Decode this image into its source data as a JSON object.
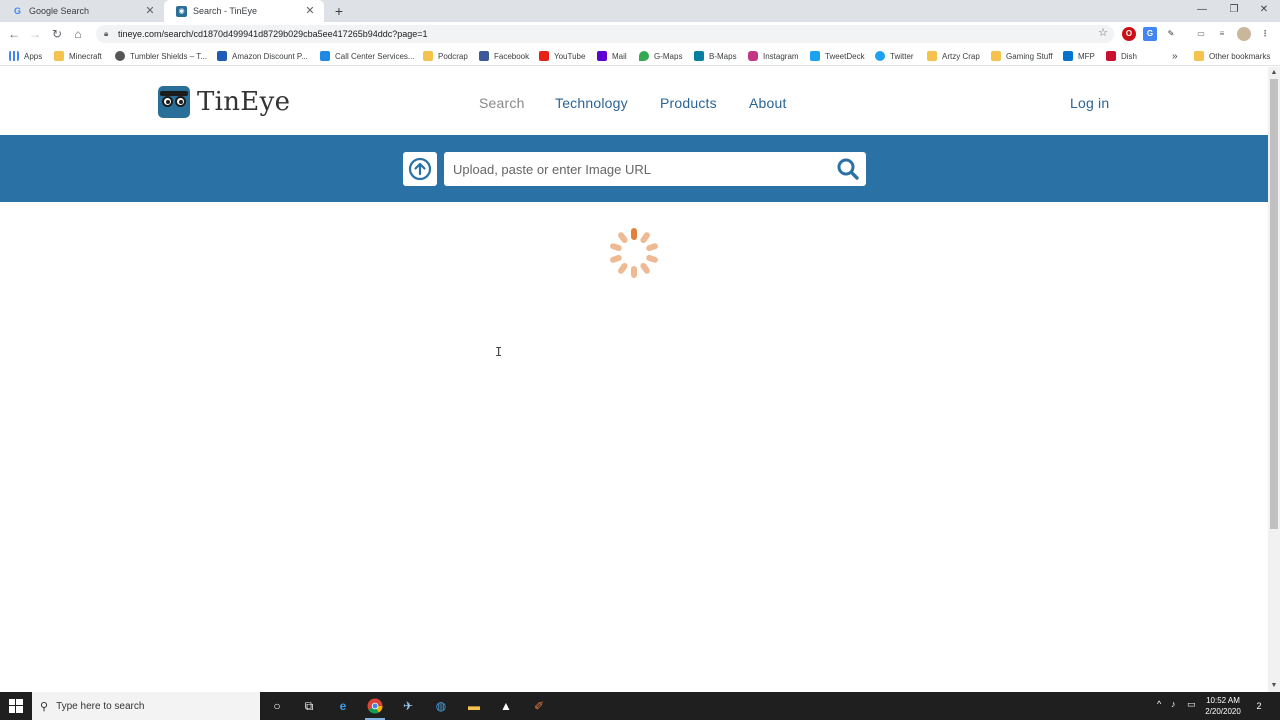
{
  "browser": {
    "tabs": [
      {
        "title": "Google Search",
        "favicon": "google-icon",
        "active": false
      },
      {
        "title": "Search - TinEye",
        "favicon": "tineye-icon",
        "active": true
      }
    ],
    "new_tab_symbol": "+",
    "address": "tineye.com/search/cd1870d499941d8729b029cba5ee417265b94ddc?page=1",
    "bookmarks": [
      {
        "label": "Apps",
        "icon": "apps-grid-icon",
        "color": "#4285f4"
      },
      {
        "label": "Minecraft",
        "icon": "folder-icon",
        "color": "#f4c24d"
      },
      {
        "label": "Tumbler Shields – T...",
        "icon": "globe-icon",
        "color": "#555555"
      },
      {
        "label": "Amazon Discount P...",
        "icon": "n-logo-icon",
        "color": "#1f5bb5"
      },
      {
        "label": "Call Center Services...",
        "icon": "page-icon",
        "color": "#1e88e5"
      },
      {
        "label": "Podcrap",
        "icon": "folder-icon",
        "color": "#f4c24d"
      },
      {
        "label": "Facebook",
        "icon": "facebook-icon",
        "color": "#3b5998"
      },
      {
        "label": "YouTube",
        "icon": "youtube-icon",
        "color": "#e62117"
      },
      {
        "label": "Mail",
        "icon": "mail-icon",
        "color": "#6001d2"
      },
      {
        "label": "G-Maps",
        "icon": "maps-pin-icon",
        "color": "#34a853"
      },
      {
        "label": "B-Maps",
        "icon": "bing-icon",
        "color": "#00809d"
      },
      {
        "label": "Instagram",
        "icon": "instagram-icon",
        "color": "#c13584"
      },
      {
        "label": "TweetDeck",
        "icon": "tweetdeck-icon",
        "color": "#1da1f2"
      },
      {
        "label": "Twitter",
        "icon": "twitter-icon",
        "color": "#1da1f2"
      },
      {
        "label": "Artzy Crap",
        "icon": "folder-icon",
        "color": "#f4c24d"
      },
      {
        "label": "Gaming Stuff",
        "icon": "folder-icon",
        "color": "#f4c24d"
      },
      {
        "label": "MFP",
        "icon": "mfp-icon",
        "color": "#0073cf"
      },
      {
        "label": "Dish",
        "icon": "dish-icon",
        "color": "#c8102e"
      }
    ],
    "more_bookmarks_symbol": "»",
    "other_bookmarks": "Other bookmarks"
  },
  "site": {
    "brand": "TinEye",
    "nav": [
      {
        "label": "Search",
        "current": true
      },
      {
        "label": "Technology",
        "current": false
      },
      {
        "label": "Products",
        "current": false
      },
      {
        "label": "About",
        "current": false
      }
    ],
    "login_label": "Log in",
    "search": {
      "placeholder": "Upload, paste or enter Image URL",
      "value": ""
    },
    "colors": {
      "band": "#2a72a5",
      "link": "#2a6496",
      "spinner": "#e0823a"
    }
  },
  "taskbar": {
    "search_placeholder": "Type here to search",
    "time": "10:52 AM",
    "date": "2/20/2020",
    "notification_count": "2"
  }
}
